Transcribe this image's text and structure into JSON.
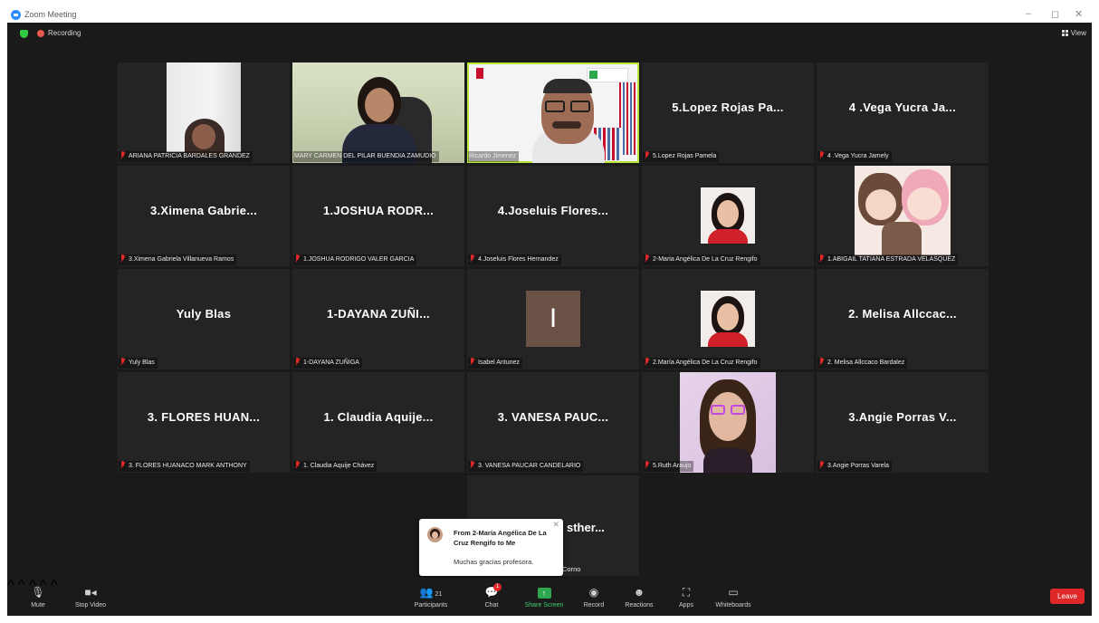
{
  "window": {
    "title": "Zoom Meeting",
    "minimize": "–",
    "maximize": "◻",
    "close": "✕"
  },
  "topbar": {
    "recording_label": "Recording",
    "view_label": "View"
  },
  "tiles": [
    {
      "label": "ARIANA PATRICIA BARDALES GRANDEZ"
    },
    {
      "label": "MARY CARMEN DEL PILAR BUENDIA ZAMUDIO"
    },
    {
      "label": "Ricardo Jimenez"
    },
    {
      "big": "5.Lopez Rojas Pa...",
      "label": "5.Lopez Rojas Pamela"
    },
    {
      "big": "4 .Vega Yucra Ja...",
      "label": "4 .Vega Yucra Jamely"
    },
    {
      "big": "3.Ximena Gabrie...",
      "label": "3.Ximena Gabriela Villanueva Ramos"
    },
    {
      "big": "1.JOSHUA RODR...",
      "label": "1.JOSHUA RODRIGO VALER GARCIA"
    },
    {
      "big": "4.Joseluis Flores...",
      "label": "4.Joseluis Flores Hernandez"
    },
    {
      "label": "2-Maria Angélica De La Cruz Rengifo"
    },
    {
      "label": "1.ABIGAIL TATIANA ESTRADA VELASQUEZ"
    },
    {
      "big": "Yuly Blas",
      "label": "Yuly Blas"
    },
    {
      "big": "1-DAYANA ZUÑI...",
      "label": "1-DAYANA ZUÑIGA"
    },
    {
      "label": "Isabel Antunez",
      "initial": "I"
    },
    {
      "label": "2.María Angélica De La Cruz Rengifo"
    },
    {
      "big": "2. Melisa Allccac...",
      "label": "2. Melisa Allccaco Bardalez"
    },
    {
      "big": "3. FLORES HUAN...",
      "label": "3. FLORES HUANACO MARK ANTHONY"
    },
    {
      "big": "1. Claudia Aquije...",
      "label": "1. Claudia Aquije Chávez"
    },
    {
      "big": "3. VANESA PAUC...",
      "label": "3. VANESA PAUCAR CANDELARIO"
    },
    {
      "label": "5.Ruth Araujo"
    },
    {
      "big": "3.Angie Porras V...",
      "label": "3.Angie Porras Varela"
    },
    {
      "big": "sther...",
      "label": "Corno"
    }
  ],
  "chat_toast": {
    "from": "From 2-María Angélica De La Cruz Rengifo to Me",
    "message": "Muchas gracias profesora."
  },
  "toolbar": {
    "mute": "Mute",
    "stop_video": "Stop Video",
    "participants": "Participants",
    "participants_count": "21",
    "chat": "Chat",
    "chat_badge": "1",
    "share_screen": "Share Screen",
    "record": "Record",
    "reactions": "Reactions",
    "apps": "Apps",
    "whiteboards": "Whiteboards",
    "leave": "Leave"
  }
}
